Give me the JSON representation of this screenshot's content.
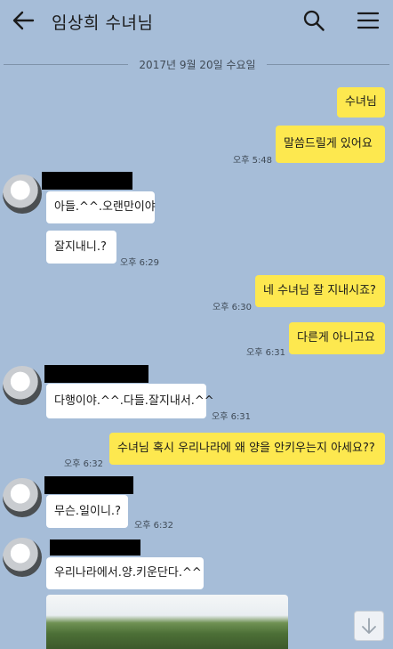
{
  "header": {
    "title": "임상희 수녀님",
    "back_icon": "arrow-left-icon",
    "search_icon": "search-icon",
    "menu_icon": "hamburger-menu-icon"
  },
  "date_divider": "2017년 9월 20일 수요일",
  "messages": [
    {
      "side": "right",
      "text": "수녀님"
    },
    {
      "side": "right",
      "text": "말씀드릴게 있어요",
      "time": "오후 5:48"
    },
    {
      "side": "left",
      "text": "아들.^^.오랜만이야"
    },
    {
      "side": "left",
      "text": "잘지내니.?",
      "time": "오후 6:29"
    },
    {
      "side": "right",
      "text": "네 수녀님 잘 지내시죠?",
      "time": "오후 6:30"
    },
    {
      "side": "right",
      "text": "다른게 아니고요",
      "time": "오후 6:31"
    },
    {
      "side": "left",
      "text": "다행이야.^^.다들.잘지내서.^^",
      "time": "오후 6:31"
    },
    {
      "side": "right",
      "text": "수녀님 혹시 우리나라에 왜 양을 안키우는지 아세요??",
      "time": "오후 6:32"
    },
    {
      "side": "left",
      "text": "무슨.일이니.?",
      "time": "오후 6:32"
    },
    {
      "side": "left",
      "text": "우리나라에서.양.키운단다.^^"
    }
  ],
  "colors": {
    "background": "#a6bdd8",
    "my_bubble": "#fde84f",
    "their_bubble": "#ffffff"
  },
  "scroll_icon": "arrow-down-icon"
}
